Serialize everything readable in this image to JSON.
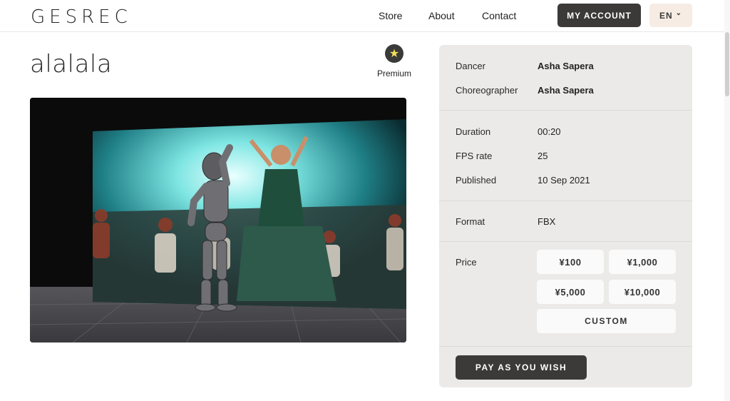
{
  "header": {
    "logo": "GESREC",
    "nav": {
      "store": "Store",
      "about": "About",
      "contact": "Contact"
    },
    "account": "MY ACCOUNT",
    "language": "EN",
    "language_caret": "⌄"
  },
  "item": {
    "title": "alalala",
    "badge_icon": "star-icon",
    "badge": "Premium"
  },
  "details": {
    "dancer_label": "Dancer",
    "dancer": "Asha Sapera",
    "choreographer_label": "Choreographer",
    "choreographer": "Asha Sapera",
    "duration_label": "Duration",
    "duration": "00:20",
    "fps_label": "FPS rate",
    "fps": "25",
    "published_label": "Published",
    "published": "10 Sep 2021",
    "format_label": "Format",
    "format": "FBX",
    "price_label": "Price",
    "prices": [
      "¥100",
      "¥1,000",
      "¥5,000",
      "¥10,000"
    ],
    "custom": "CUSTOM",
    "pay": "PAY AS YOU WISH"
  },
  "colors": {
    "dark_button": "#3b3a39",
    "panel_bg": "#ebeae8",
    "lang_bg": "#f6ece3",
    "star": "#f4df5b"
  }
}
